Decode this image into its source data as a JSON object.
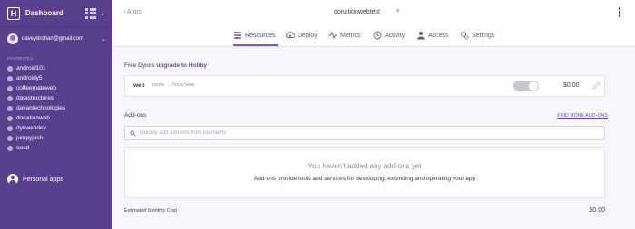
{
  "sidebar": {
    "title": "Dashboard",
    "logo_letter": "H",
    "account_email": "daveydrohan@gmail.com",
    "favorites_label": "FAVORITES",
    "favorites": [
      "android101",
      "androidy5",
      "coffeemateweb",
      "datastructures",
      "davantechnologies",
      "donationweb",
      "dynwebdev",
      "jumpyjosh",
      "oosd"
    ],
    "personal_apps_label": "Personal apps"
  },
  "header": {
    "back_label": "Apps",
    "app_name": "donationwebtest"
  },
  "tabs": [
    {
      "label": "Resources",
      "icon": "resources-icon"
    },
    {
      "label": "Deploy",
      "icon": "deploy-icon"
    },
    {
      "label": "Metrics",
      "icon": "metrics-icon"
    },
    {
      "label": "Activity",
      "icon": "activity-icon"
    },
    {
      "label": "Access",
      "icon": "access-icon"
    },
    {
      "label": "Settings",
      "icon": "settings-icon"
    }
  ],
  "active_tab": "Resources",
  "dynos": {
    "heading_prefix": "Free Dynos",
    "heading_link": "upgrade to Hobby",
    "name": "web",
    "command": "node ./bin/www",
    "enabled": true,
    "cost": "$0.00"
  },
  "addons": {
    "heading": "Add-ons",
    "find_more_label": "FIND MORE ADD-ONS",
    "search_placeholder": "Quickly add add-ons from Elements",
    "empty_title": "You haven't added any add-ons yet",
    "empty_subtitle": "Add-ons provide tools and services for developing, extending and operating your app"
  },
  "footer": {
    "label": "Estimated Monthly Cost",
    "cost": "$0.00"
  },
  "colors": {
    "sidebar": "#5b3f8f",
    "accent": "#6a4ab0",
    "background": "#f7f7fb"
  }
}
